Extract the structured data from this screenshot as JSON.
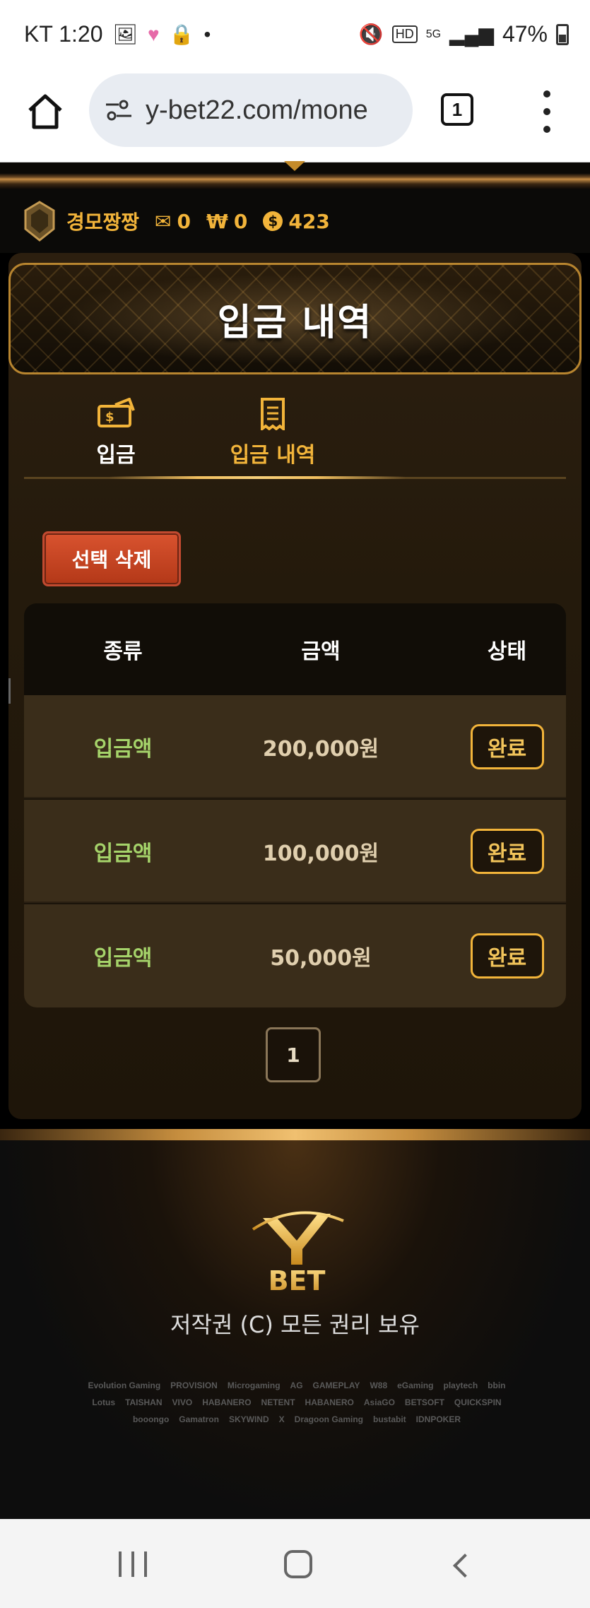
{
  "status_bar": {
    "carrier_time": "KT 1:20",
    "battery": "47%"
  },
  "browser": {
    "url": "y-bet22.com/mone",
    "tab_count": "1",
    "home_icon": "home-icon",
    "menu_icon": "more-vert-icon"
  },
  "user": {
    "name": "경모짱짱",
    "messages": "0",
    "won": "0",
    "coin_symbol": "$",
    "points": "423"
  },
  "banner": {
    "title": "입금 내역"
  },
  "tabs": [
    {
      "label": "입금",
      "icon": "money-icon"
    },
    {
      "label": "입금 내역",
      "icon": "receipt-icon"
    }
  ],
  "actions": {
    "delete_selected": "선택 삭제"
  },
  "table": {
    "headers": [
      "종류",
      "금액",
      "상태"
    ],
    "rows": [
      {
        "type": "입금액",
        "amount": "200,000원",
        "status": "완료"
      },
      {
        "type": "입금액",
        "amount": "100,000원",
        "status": "완료"
      },
      {
        "type": "입금액",
        "amount": "50,000원",
        "status": "완료"
      }
    ]
  },
  "pagination": {
    "current": "1"
  },
  "footer": {
    "logo_text": "BET",
    "copyright": "저작권 (C) 모든 권리 보유",
    "providers": [
      "Evolution Gaming",
      "PROVISION",
      "Microgaming",
      "AG",
      "GAMEPLAY",
      "W88",
      "eGaming",
      "playtech",
      "bbin",
      "Lotus",
      "TAISHAN",
      "VIVO",
      "HABANERO",
      "NETENT",
      "HABANERO",
      "AsiaGO",
      "BETSOFT",
      "QUICKSPIN",
      "booongo",
      "Gamatron",
      "SKYWIND",
      "X",
      "Dragoon Gaming",
      "bustabit",
      "IDNPOKER"
    ]
  }
}
